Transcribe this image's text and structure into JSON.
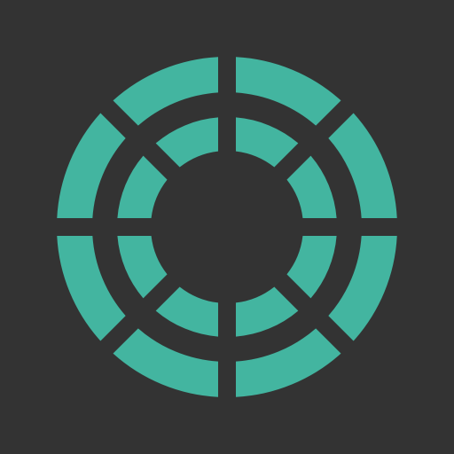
{
  "icon": {
    "name": "segmented-concentric-rings-icon",
    "colors": {
      "background": "#333333",
      "segment": "#43B5A0"
    },
    "outer_ring_segment_count": 8,
    "inner_ring_segment_count": 8
  }
}
